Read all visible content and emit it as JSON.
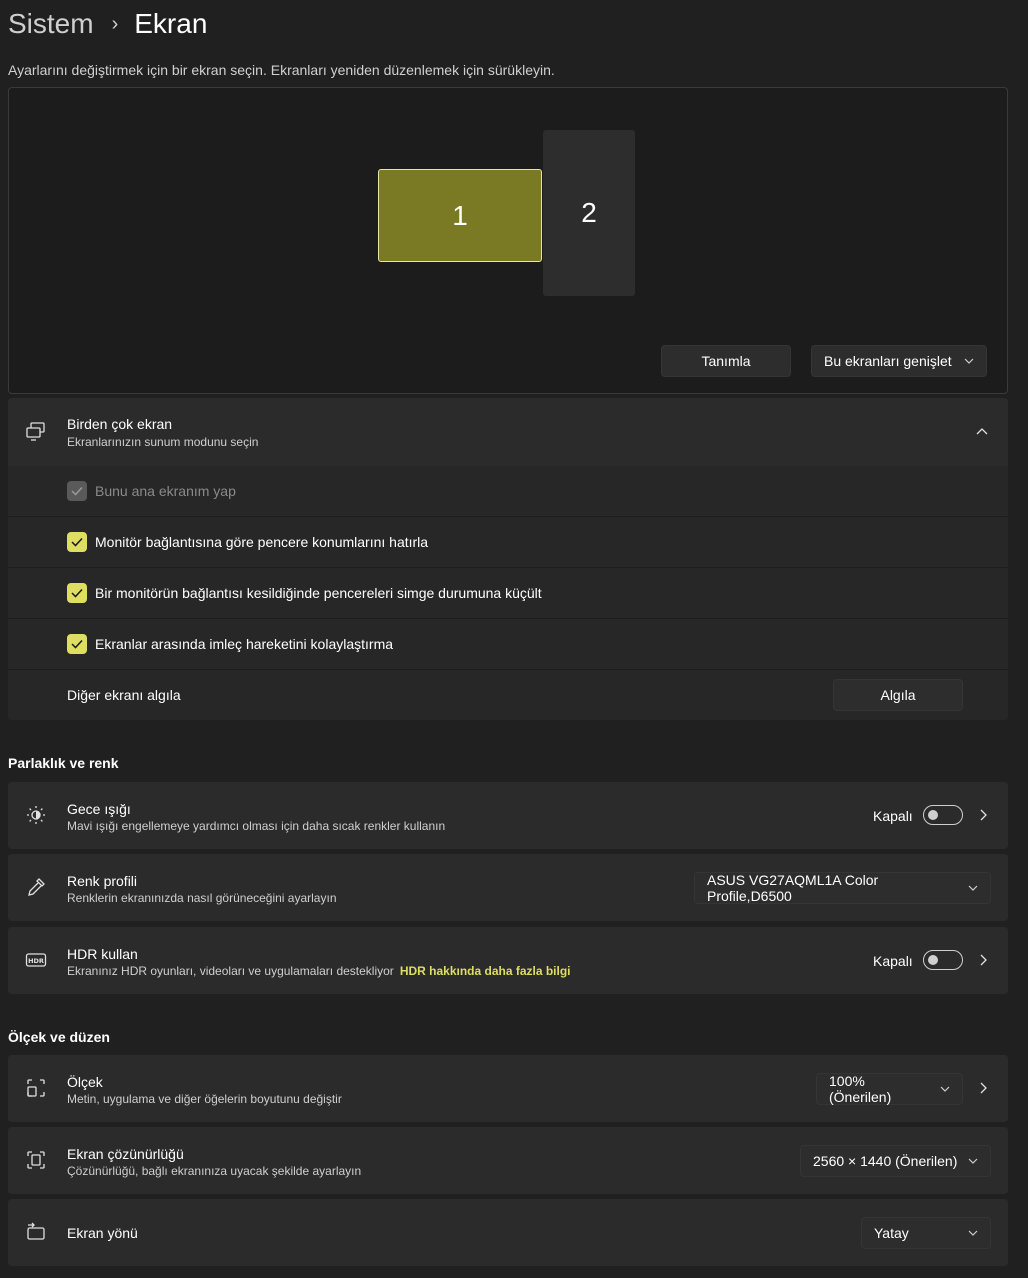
{
  "breadcrumb": {
    "parent": "Sistem",
    "separator": "›",
    "current": "Ekran"
  },
  "instruction": "Ayarlarını değiştirmek için bir ekran seçin. Ekranları yeniden düzenlemek için sürükleyin.",
  "arrangement": {
    "monitors": [
      {
        "label": "1",
        "selected": true
      },
      {
        "label": "2",
        "selected": false
      }
    ],
    "identify_label": "Tanımla",
    "mode_value": "Bu ekranları genişlet"
  },
  "multiple_displays": {
    "title": "Birden çok ekran",
    "subtitle": "Ekranlarınızın sunum modunu seçin",
    "options": [
      {
        "label": "Bunu ana ekranım yap",
        "checked": true,
        "disabled": true
      },
      {
        "label": "Monitör bağlantısına göre pencere konumlarını hatırla",
        "checked": true,
        "disabled": false
      },
      {
        "label": "Bir monitörün bağlantısı kesildiğinde pencereleri simge durumuna küçült",
        "checked": true,
        "disabled": false
      },
      {
        "label": "Ekranlar arasında imleç hareketini kolaylaştırma",
        "checked": true,
        "disabled": false
      }
    ],
    "detect_row_label": "Diğer ekranı algıla",
    "detect_button": "Algıla"
  },
  "brightness_section": {
    "title": "Parlaklık ve renk",
    "night_light": {
      "title": "Gece ışığı",
      "subtitle": "Mavi ışığı engellemeye yardımcı olması için daha sıcak renkler kullanın",
      "state": "Kapalı"
    },
    "color_profile": {
      "title": "Renk profili",
      "subtitle": "Renklerin ekranınızda nasıl görüneceğini ayarlayın",
      "value": "ASUS VG27AQML1A Color Profile,D6500"
    },
    "hdr": {
      "title": "HDR kullan",
      "subtitle": "Ekranınız HDR oyunları, videoları ve uygulamaları destekliyor",
      "link": "HDR hakkında daha fazla bilgi",
      "state": "Kapalı",
      "icon_text": "HDR"
    }
  },
  "scale_section": {
    "title": "Ölçek ve düzen",
    "scale": {
      "title": "Ölçek",
      "subtitle": "Metin, uygulama ve diğer öğelerin boyutunu değiştir",
      "value": "100% (Önerilen)"
    },
    "resolution": {
      "title": "Ekran çözünürlüğü",
      "subtitle": "Çözünürlüğü, bağlı ekranınıza uyacak şekilde ayarlayın",
      "value": "2560 × 1440 (Önerilen)"
    },
    "orientation": {
      "title": "Ekran yönü",
      "value": "Yatay"
    }
  },
  "colors": {
    "accent": "#dede62",
    "selected_monitor": "#7a7a24",
    "background": "#202020",
    "card": "#2b2b2b"
  }
}
